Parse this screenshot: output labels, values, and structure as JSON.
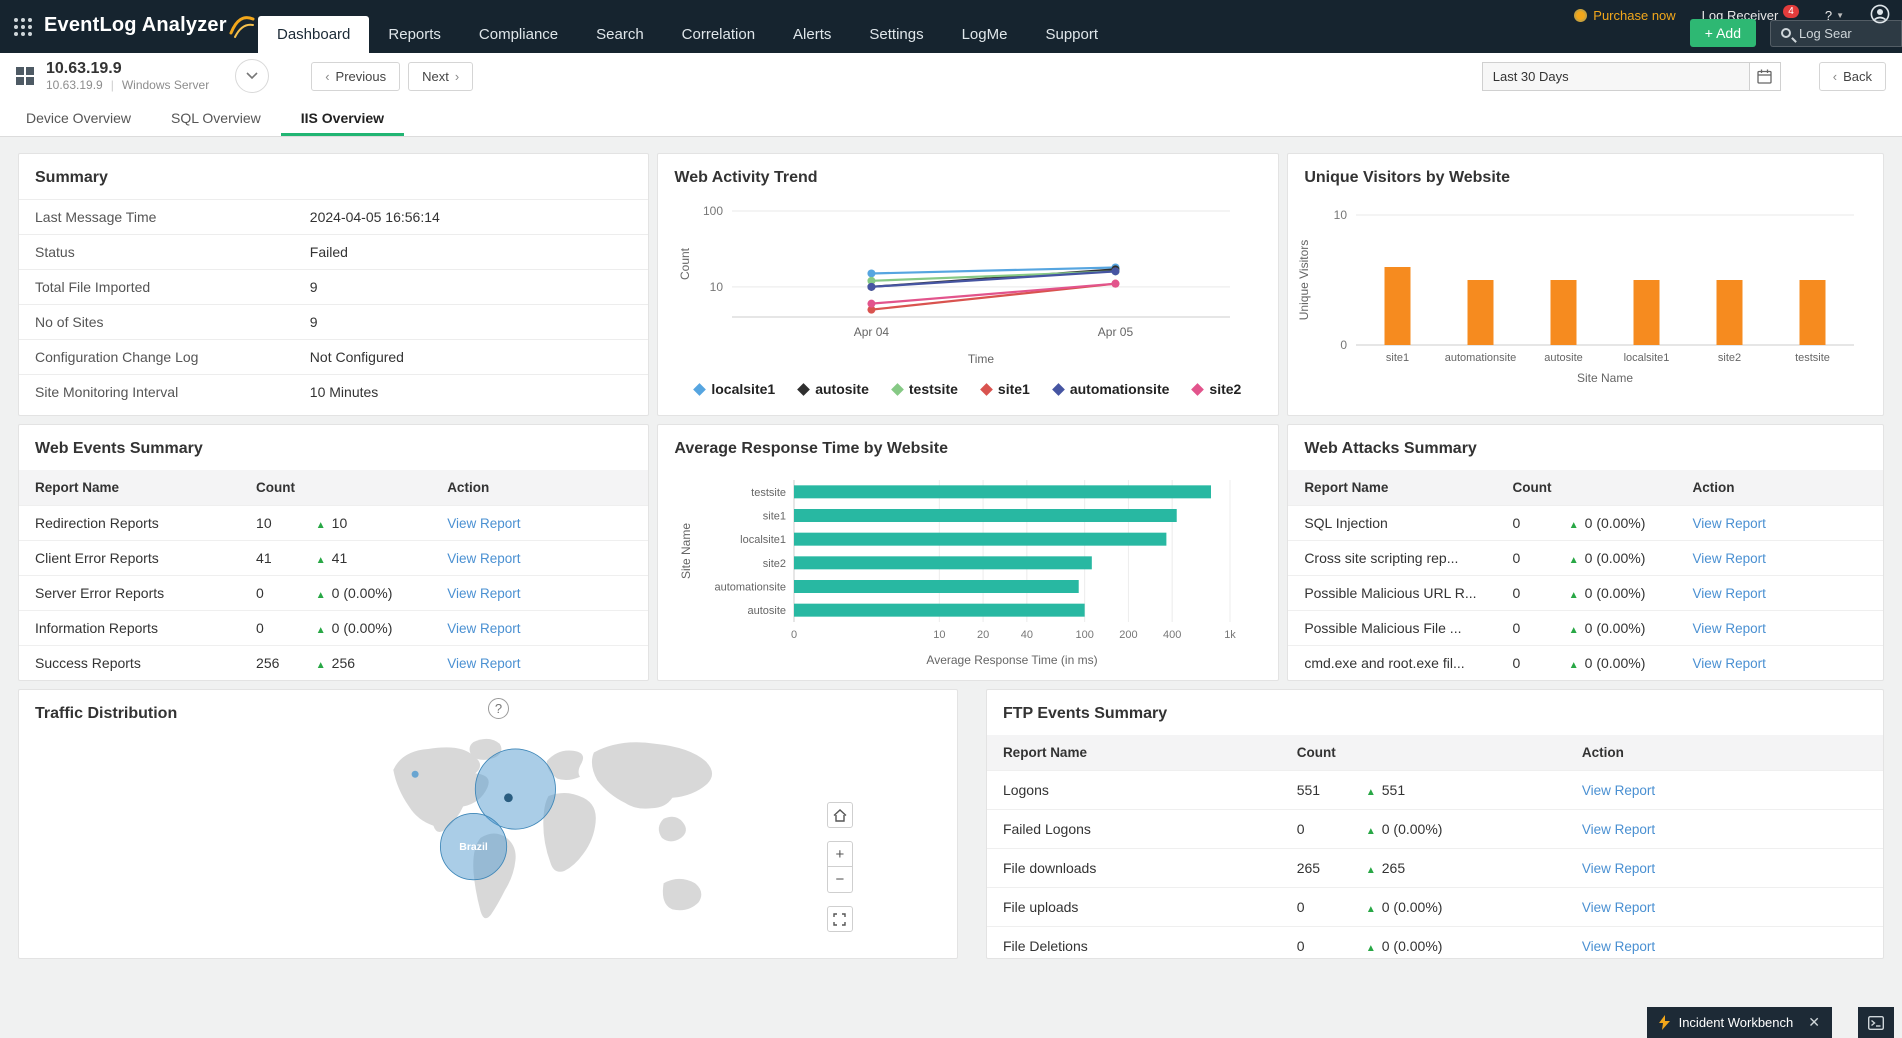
{
  "topnav": {
    "logo_text": "EventLog Analyzer",
    "tabs": [
      {
        "label": "Dashboard",
        "active": true
      },
      {
        "label": "Reports"
      },
      {
        "label": "Compliance"
      },
      {
        "label": "Search"
      },
      {
        "label": "Correlation"
      },
      {
        "label": "Alerts"
      },
      {
        "label": "Settings"
      },
      {
        "label": "LogMe"
      },
      {
        "label": "Support"
      }
    ],
    "purchase_label": "Purchase now",
    "log_receiver_label": "Log Receiver",
    "log_receiver_badge": "4",
    "help_label": "?",
    "add_label": "+ Add",
    "search_placeholder": "Log Sear"
  },
  "device_header": {
    "title": "10.63.19.9",
    "ip": "10.63.19.9",
    "device_type": "Windows Server",
    "previous_label": "Previous",
    "next_label": "Next",
    "time_range": "Last 30 Days",
    "back_label": "Back"
  },
  "view_tabs": [
    {
      "label": "Device Overview"
    },
    {
      "label": "SQL Overview"
    },
    {
      "label": "IIS Overview",
      "active": true
    }
  ],
  "summary": {
    "title": "Summary",
    "rows": [
      {
        "label": "Last Message Time",
        "value": "2024-04-05 16:56:14"
      },
      {
        "label": "Status",
        "value": "Failed"
      },
      {
        "label": "Total File Imported",
        "value": "9"
      },
      {
        "label": "No of Sites",
        "value": "9"
      },
      {
        "label": "Configuration Change Log",
        "value": "Not Configured"
      },
      {
        "label": "Site Monitoring Interval",
        "value": "10 Minutes"
      }
    ]
  },
  "web_events": {
    "title": "Web Events Summary",
    "columns": [
      "Report Name",
      "Count",
      "Action"
    ],
    "action_label": "View Report",
    "rows": [
      {
        "name": "Redirection Reports",
        "count": "10",
        "delta": "10"
      },
      {
        "name": "Client Error Reports",
        "count": "41",
        "delta": "41"
      },
      {
        "name": "Server Error Reports",
        "count": "0",
        "delta": "0 (0.00%)"
      },
      {
        "name": "Information Reports",
        "count": "0",
        "delta": "0 (0.00%)"
      },
      {
        "name": "Success Reports",
        "count": "256",
        "delta": "256"
      }
    ]
  },
  "web_attacks": {
    "title": "Web Attacks Summary",
    "columns": [
      "Report Name",
      "Count",
      "Action"
    ],
    "action_label": "View Report",
    "rows": [
      {
        "name": "SQL Injection",
        "count": "0",
        "delta": "0 (0.00%)"
      },
      {
        "name": "Cross site scripting rep...",
        "count": "0",
        "delta": "0 (0.00%)"
      },
      {
        "name": "Possible Malicious URL R...",
        "count": "0",
        "delta": "0 (0.00%)"
      },
      {
        "name": "Possible Malicious File ...",
        "count": "0",
        "delta": "0 (0.00%)"
      },
      {
        "name": "cmd.exe and root.exe fil...",
        "count": "0",
        "delta": "0 (0.00%)"
      }
    ]
  },
  "ftp_events": {
    "title": "FTP Events Summary",
    "columns": [
      "Report Name",
      "Count",
      "Action"
    ],
    "action_label": "View Report",
    "rows": [
      {
        "name": "Logons",
        "count": "551",
        "delta": "551"
      },
      {
        "name": "Failed Logons",
        "count": "0",
        "delta": "0 (0.00%)"
      },
      {
        "name": "File downloads",
        "count": "265",
        "delta": "265"
      },
      {
        "name": "File uploads",
        "count": "0",
        "delta": "0 (0.00%)"
      },
      {
        "name": "File Deletions",
        "count": "0",
        "delta": "0 (0.00%)"
      }
    ]
  },
  "traffic": {
    "title": "Traffic Distribution",
    "help_label": "?",
    "map_label_brazil": "Brazil",
    "controls": {
      "zoom_in": "+",
      "zoom_out": "−"
    }
  },
  "incident": {
    "label": "Incident Workbench",
    "close": "✕"
  },
  "colors": {
    "topbar_bg": "#16242f",
    "accent_green": "#2eb873",
    "tab_underline_green": "#21b573",
    "link_blue": "#4a90d2",
    "delta_green": "#28a745",
    "visitors_bar_orange": "#f68b1f",
    "response_bar_teal": "#28b8a2",
    "purchase_orange": "#f2a71b",
    "badge_red": "#e23c3c"
  },
  "chart_data": [
    {
      "type": "line",
      "title": "Web Activity Trend",
      "x": [
        "Apr 04",
        "Apr 05"
      ],
      "xlabel": "Time",
      "ylabel": "Count",
      "yscale": "log",
      "yticks": [
        10,
        100
      ],
      "ylim": [
        4,
        100
      ],
      "legend_position": "bottom",
      "series": [
        {
          "name": "localsite1",
          "color": "#56a5e0",
          "values": [
            15,
            18
          ]
        },
        {
          "name": "autosite",
          "color": "#2f2f2f",
          "values": [
            10,
            17
          ]
        },
        {
          "name": "testsite",
          "color": "#86c985",
          "values": [
            12,
            16
          ]
        },
        {
          "name": "site1",
          "color": "#d9534f",
          "values": [
            5,
            11
          ]
        },
        {
          "name": "automationsite",
          "color": "#4655a2",
          "values": [
            10,
            16
          ]
        },
        {
          "name": "site2",
          "color": "#e2548c",
          "values": [
            6,
            11
          ]
        }
      ]
    },
    {
      "type": "bar",
      "title": "Unique Visitors by Website",
      "categories": [
        "site1",
        "automationsite",
        "autosite",
        "localsite1",
        "site2",
        "testsite"
      ],
      "values": [
        6,
        5,
        5,
        5,
        5,
        5
      ],
      "xlabel": "Site Name",
      "ylabel": "Unique Visitors",
      "yticks": [
        0,
        10
      ],
      "ylim": [
        0,
        10
      ],
      "grid": true,
      "color": "#f68b1f"
    },
    {
      "type": "hbar",
      "title": "Average Response Time by Website",
      "categories": [
        "testsite",
        "site1",
        "localsite1",
        "site2",
        "automationsite",
        "autosite"
      ],
      "values": [
        740,
        430,
        365,
        112,
        91,
        100
      ],
      "xlabel": "Average Response Time (in ms)",
      "ylabel": "Site Name",
      "xscale": "log",
      "xlim": [
        1,
        1000
      ],
      "xticks": [
        {
          "label": "0",
          "value": 1
        },
        {
          "label": "10",
          "value": 10
        },
        {
          "label": "20",
          "value": 20
        },
        {
          "label": "40",
          "value": 40
        },
        {
          "label": "100",
          "value": 100
        },
        {
          "label": "200",
          "value": 200
        },
        {
          "label": "400",
          "value": 400
        },
        {
          "label": "1k",
          "value": 1000
        }
      ],
      "grid": true,
      "color": "#28b8a2"
    }
  ]
}
